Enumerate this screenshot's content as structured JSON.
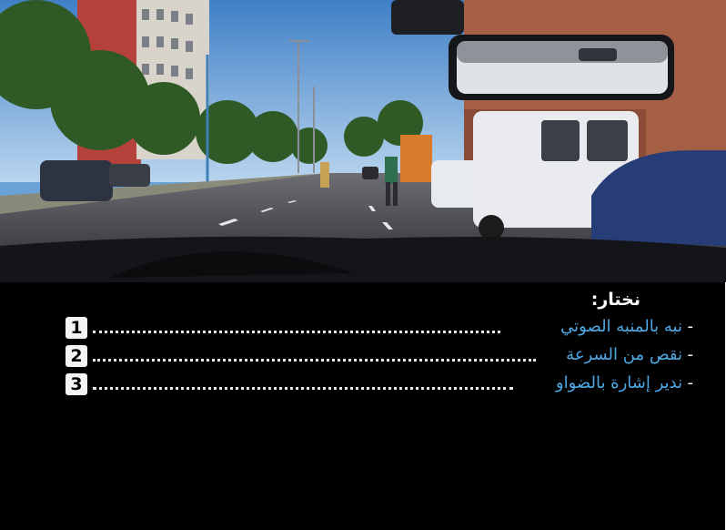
{
  "question": {
    "prompt": "نختار:",
    "options": [
      {
        "number": "1",
        "text": "نبه بالمنبه الصوتي",
        "dash": "-"
      },
      {
        "number": "2",
        "text": "نقص من السرعة",
        "dash": "-"
      },
      {
        "number": "3",
        "text": "ندير إشارة بالضواو",
        "dash": "-"
      }
    ]
  },
  "colors": {
    "panel_background": "#000000",
    "prompt_text": "#ffffff",
    "option_text": "#4fa8e4",
    "badge_background": "#f4f4f4",
    "sky": "#6aa2d8",
    "road": "#4a4b50"
  }
}
